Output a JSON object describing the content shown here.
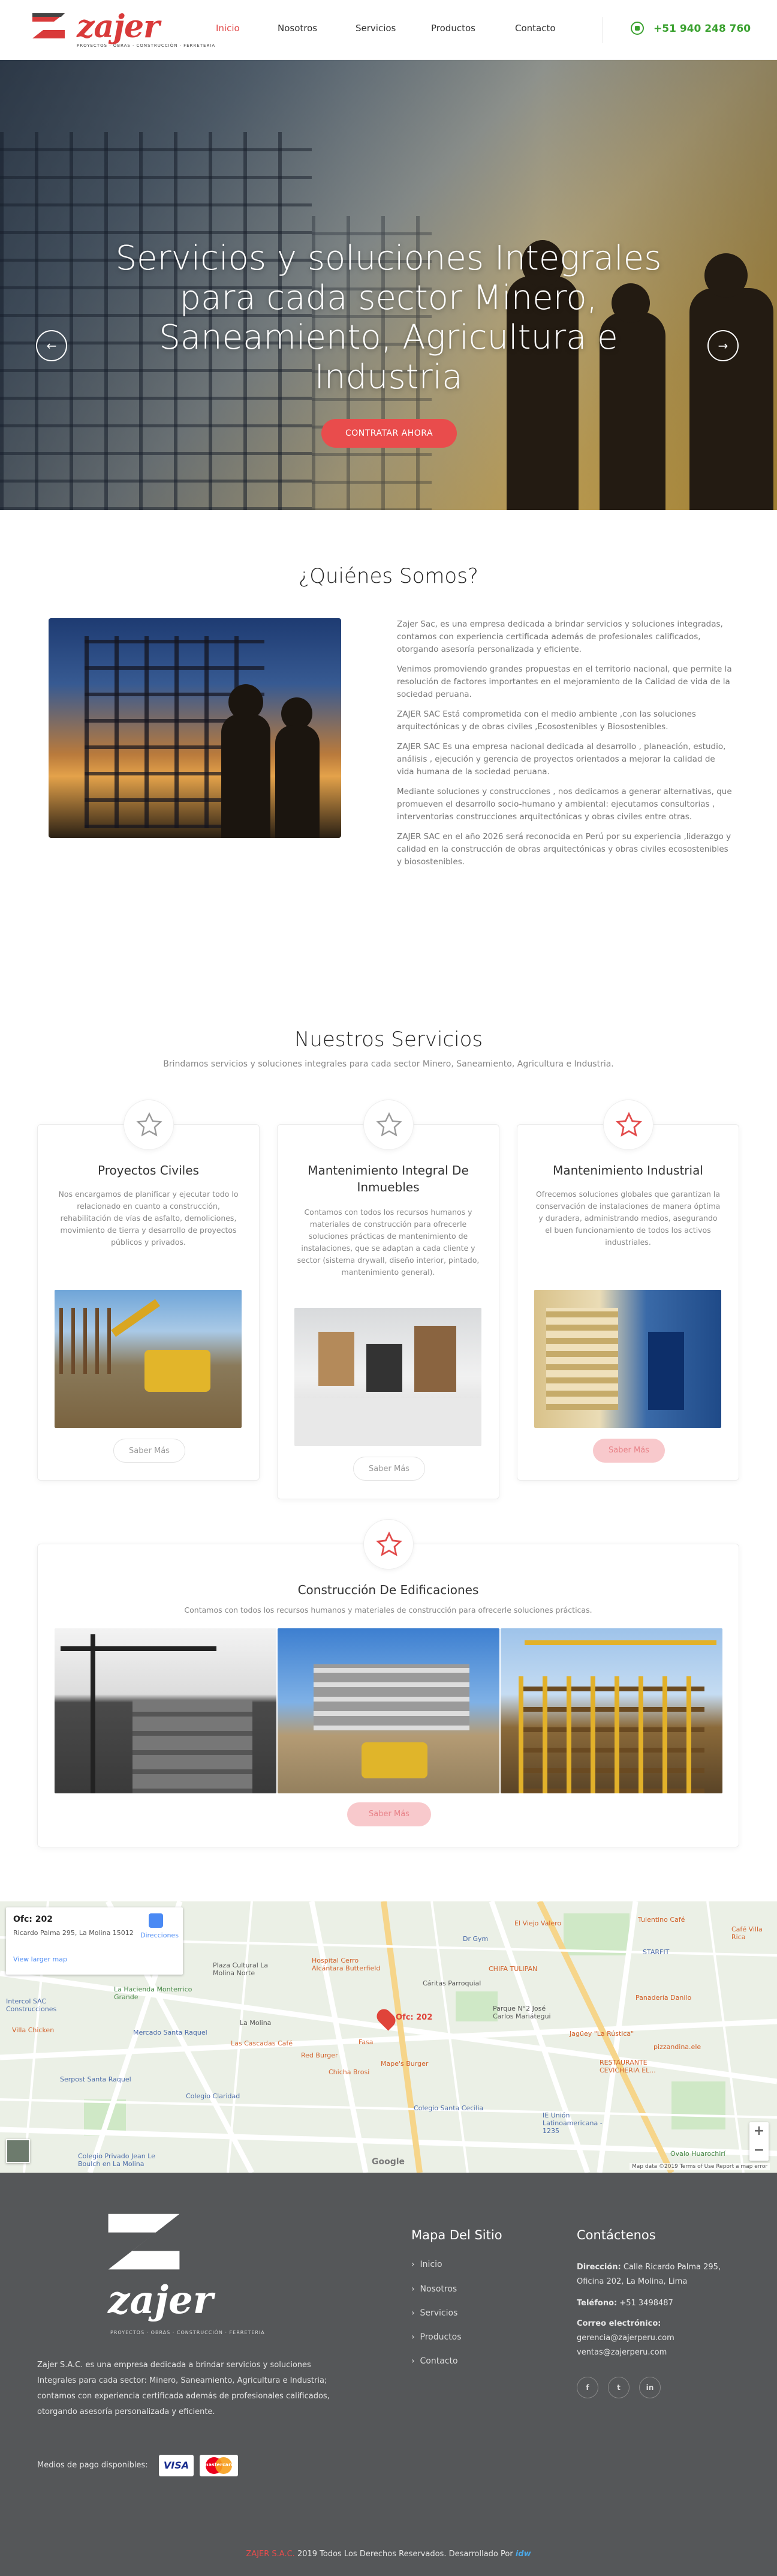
{
  "header": {
    "logo_word": "zajer",
    "logo_tagline": "PROYECTOS · OBRAS · CONSTRUCCIÓN · FERRETERIA",
    "nav": [
      "Inicio",
      "Nosotros",
      "Servicios",
      "Productos",
      "Contacto"
    ],
    "active_nav": "Inicio",
    "phone": "+51 940 248 760",
    "phone_icon": "whatsapp-icon"
  },
  "hero": {
    "title": "Servicios y soluciones Integrales para cada sector Minero, Saneamiento, Agricultura e Industria",
    "cta": "CONTRATAR AHORA",
    "prev_icon": "arrow-left-icon",
    "next_icon": "arrow-right-icon"
  },
  "about": {
    "title": "¿Quiénes Somos?",
    "paragraphs": [
      "Zajer Sac, es una empresa dedicada a brindar servicios y soluciones integradas, contamos con experiencia certificada además de profesionales calificados, otorgando asesoría personalizada y eficiente.",
      "Venimos promoviendo grandes propuestas en el territorio nacional, que permite la resolución de factores importantes en el mejoramiento de la Calidad de vida de la sociedad peruana.",
      "ZAJER SAC Está comprometida con el medio ambiente ,con las soluciones arquitectónicas y de obras civiles ,Ecosostenibles y Biosostenibles.",
      "ZAJER SAC Es una empresa nacional dedicada al desarrollo , planeación, estudio, análisis , ejecución y gerencia de proyectos orientados a mejorar la calidad de vida humana de la sociedad peruana.",
      "Mediante soluciones y construcciones , nos dedicamos a generar alternativas, que promueven el desarrollo socio-humano y ambiental: ejecutamos consultorias , interventorias construcciones arquitectónicas y obras civiles entre otras.",
      "ZAJER SAC en el año 2026 será reconocida en Perú por su experiencia ,liderazgo y calidad en la construcción de obras arquitectónicas y obras civiles ecosostenibles y biosostenibles."
    ]
  },
  "services": {
    "title": "Nuestros Servicios",
    "subtitle": "Brindamos servicios y soluciones integrales para cada sector Minero, Saneamiento, Agricultura e Industria.",
    "button_label": "Saber Más",
    "cards": [
      {
        "title": "Proyectos Civiles",
        "text": "Nos encargamos de planificar y ejecutar todo lo relacionado en cuanto a construcción, rehabilitación de vías de asfalto, demoliciones, movimiento de tierra y desarrollo de proyectos públicos y privados.",
        "icon": "star-outline-icon"
      },
      {
        "title": "Mantenimiento Integral De Inmuebles",
        "text": "Contamos con todos los recursos humanos y materiales de construcción para ofrecerle soluciones prácticas de mantenimiento de instalaciones, que se adaptan a cada cliente y sector (sistema drywall, diseño interior, pintado, mantenimiento general).",
        "icon": "star-outline-icon"
      },
      {
        "title": "Mantenimiento Industrial",
        "text": "Ofrecemos soluciones globales que garantizan la conservación de instalaciones de manera óptima y duradera, administrando medios, asegurando el buen funcionamiento de todos los activos industriales.",
        "icon": "star-red-icon"
      },
      {
        "title": "Construcción De Edificaciones",
        "text": "Contamos con todos los recursos humanos y materiales de construcción para ofrecerle soluciones prácticas.",
        "icon": "star-red-icon"
      }
    ]
  },
  "map": {
    "place_title": "Ofc: 202",
    "place_address": "Ricardo Palma 295, La Molina 15012",
    "directions": "Direcciones",
    "larger_map": "View larger map",
    "pin_label": "Ofc: 202",
    "labels": [
      "El Viejo Valero",
      "Tulentino Café",
      "Café Villa Rica",
      "Plaza Cultural La Molina Norte",
      "Hospital Cerro Alcántara Butterfield",
      "Dr Gym",
      "STARFIT",
      "CHIFA TULIPAN",
      "Panadería Danilo",
      "Intercol SAC Construcciones",
      "La Hacienda Monterrico Grande",
      "La Molina",
      "Villa Chicken",
      "Mercado Santa Raquel",
      "Cáritas Parroquial",
      "Parque N°2 José Carlos Mariátegui",
      "Jagüey \"La Rústica\"",
      "Las Cascadas Café",
      "Fasa",
      "Red Burger",
      "Mape's Burger",
      "Chicha Brosi",
      "RESTAURANTE CEVICHERIA EL...",
      "pizzandina.ele",
      "Serpost Santa Raquel",
      "Colegio Claridad",
      "Colegio Santa Cecilia",
      "IE Unión Latinoamericana - 1235",
      "Óvalo Huarochirí",
      "Colegio Privado Jean Le Boulch en La Molina"
    ],
    "attribution": "Map data ©2019   Terms of Use   Report a map error",
    "google": "Google"
  },
  "footer": {
    "about": "Zajer S.A.C. es una empresa dedicada a brindar servicios y soluciones Integrales para cada sector: Minero, Saneamiento, Agricultura e Industria; contamos con experiencia certificada además de profesionales calificados, otorgando asesoría personalizada y eficiente.",
    "payment_label": "Medios de pago disponibles:",
    "visa": "VISA",
    "mastercard": "mastercard",
    "sitemap_title": "Mapa Del Sitio",
    "sitemap": [
      "Inicio",
      "Nosotros",
      "Servicios",
      "Productos",
      "Contacto"
    ],
    "contact_title": "Contáctenos",
    "address_label": "Dirección:",
    "address": "Calle Ricardo Palma 295, Oficina 202, La Molina, Lima",
    "phone_label": "Teléfono:",
    "phone": "+51 3498487",
    "email_label": "Correo electrónico:",
    "emails": [
      "gerencia@zajerperu.com",
      "ventas@zajerperu.com"
    ],
    "social": [
      {
        "icon": "facebook-icon",
        "glyph": "f"
      },
      {
        "icon": "twitter-icon",
        "glyph": "t"
      },
      {
        "icon": "linkedin-icon",
        "glyph": "in"
      }
    ],
    "copyright_brand": "ZAJER S.A.C.",
    "copyright": "2019 Todos Los Derechos Reservados. Desarrollado Por",
    "dev_brand": "idw"
  },
  "colors": {
    "accent": "#e94c4c",
    "whatsapp": "#3aa12f",
    "footer_bg": "#555759"
  }
}
